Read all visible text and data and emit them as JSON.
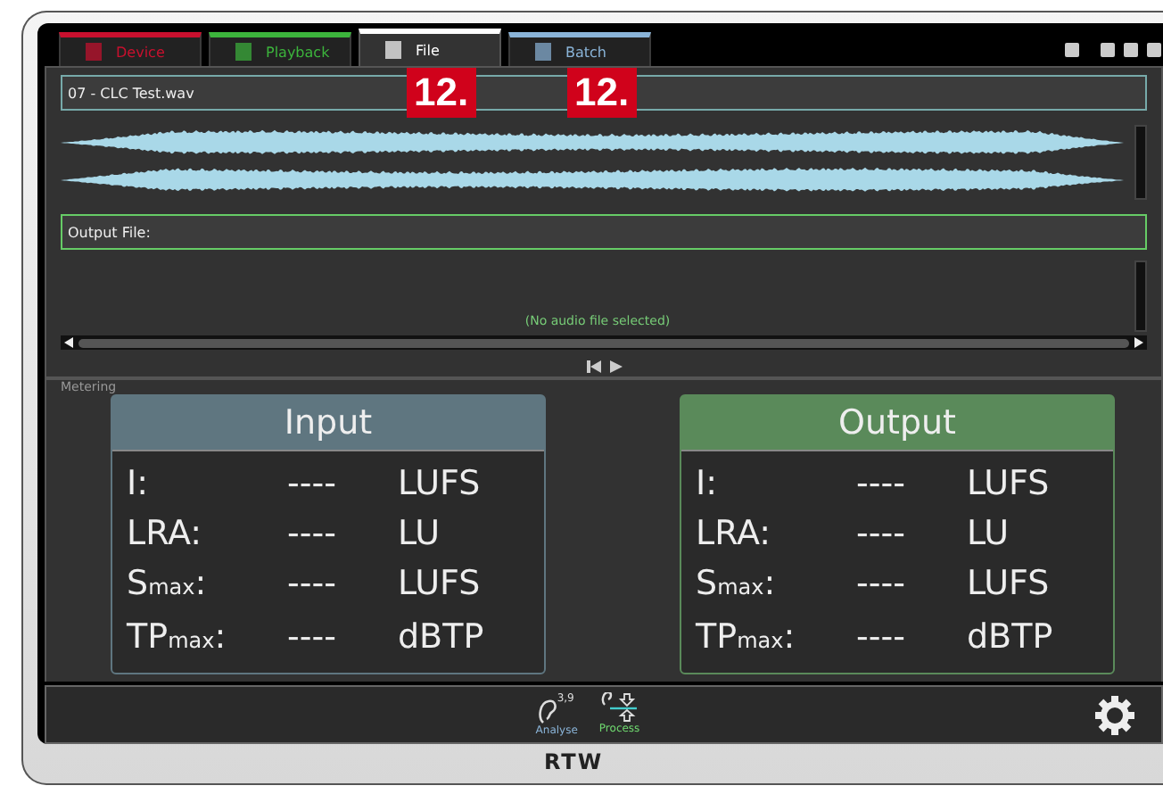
{
  "tabs": [
    {
      "label": "Device",
      "selected": false,
      "color": "#c8102e"
    },
    {
      "label": "Playback",
      "selected": false,
      "color": "#3cb43c"
    },
    {
      "label": "File",
      "selected": true,
      "color": "#ffffff"
    },
    {
      "label": "Batch",
      "selected": false,
      "color": "#8ab4d8"
    }
  ],
  "callouts": [
    "12.",
    "12."
  ],
  "input_file": {
    "value": "07 - CLC Test.wav"
  },
  "output_file": {
    "value": "Output File:"
  },
  "output_status": "(No audio file selected)",
  "metering": {
    "label": "Metering",
    "panels": [
      {
        "title": "Input",
        "color": "#5f7680",
        "rows": [
          {
            "label": "I:",
            "value": "----",
            "unit": "LUFS"
          },
          {
            "label": "LRA:",
            "value": "----",
            "unit": "LU"
          },
          {
            "label": "S$_{max}$:",
            "value": "----",
            "unit": "LUFS"
          },
          {
            "label": "TP$_{max}$:",
            "value": "----",
            "unit": "dBTP"
          }
        ]
      },
      {
        "title": "Output",
        "color": "#5a8a5a",
        "rows": [
          {
            "label": "I:",
            "value": "----",
            "unit": "LUFS"
          },
          {
            "label": "LRA:",
            "value": "----",
            "unit": "LU"
          },
          {
            "label": "S$_{max}$:",
            "value": "----",
            "unit": "LUFS"
          },
          {
            "label": "TP$_{max}$:",
            "value": "----",
            "unit": "dBTP"
          }
        ]
      }
    ]
  },
  "modes": [
    {
      "label": "Analyse",
      "badge": "3,9",
      "kind": "analyse",
      "color": "#8ab4d8"
    },
    {
      "label": "Process",
      "kind": "process",
      "color": "#6fd86f"
    }
  ],
  "brand": "RTW"
}
